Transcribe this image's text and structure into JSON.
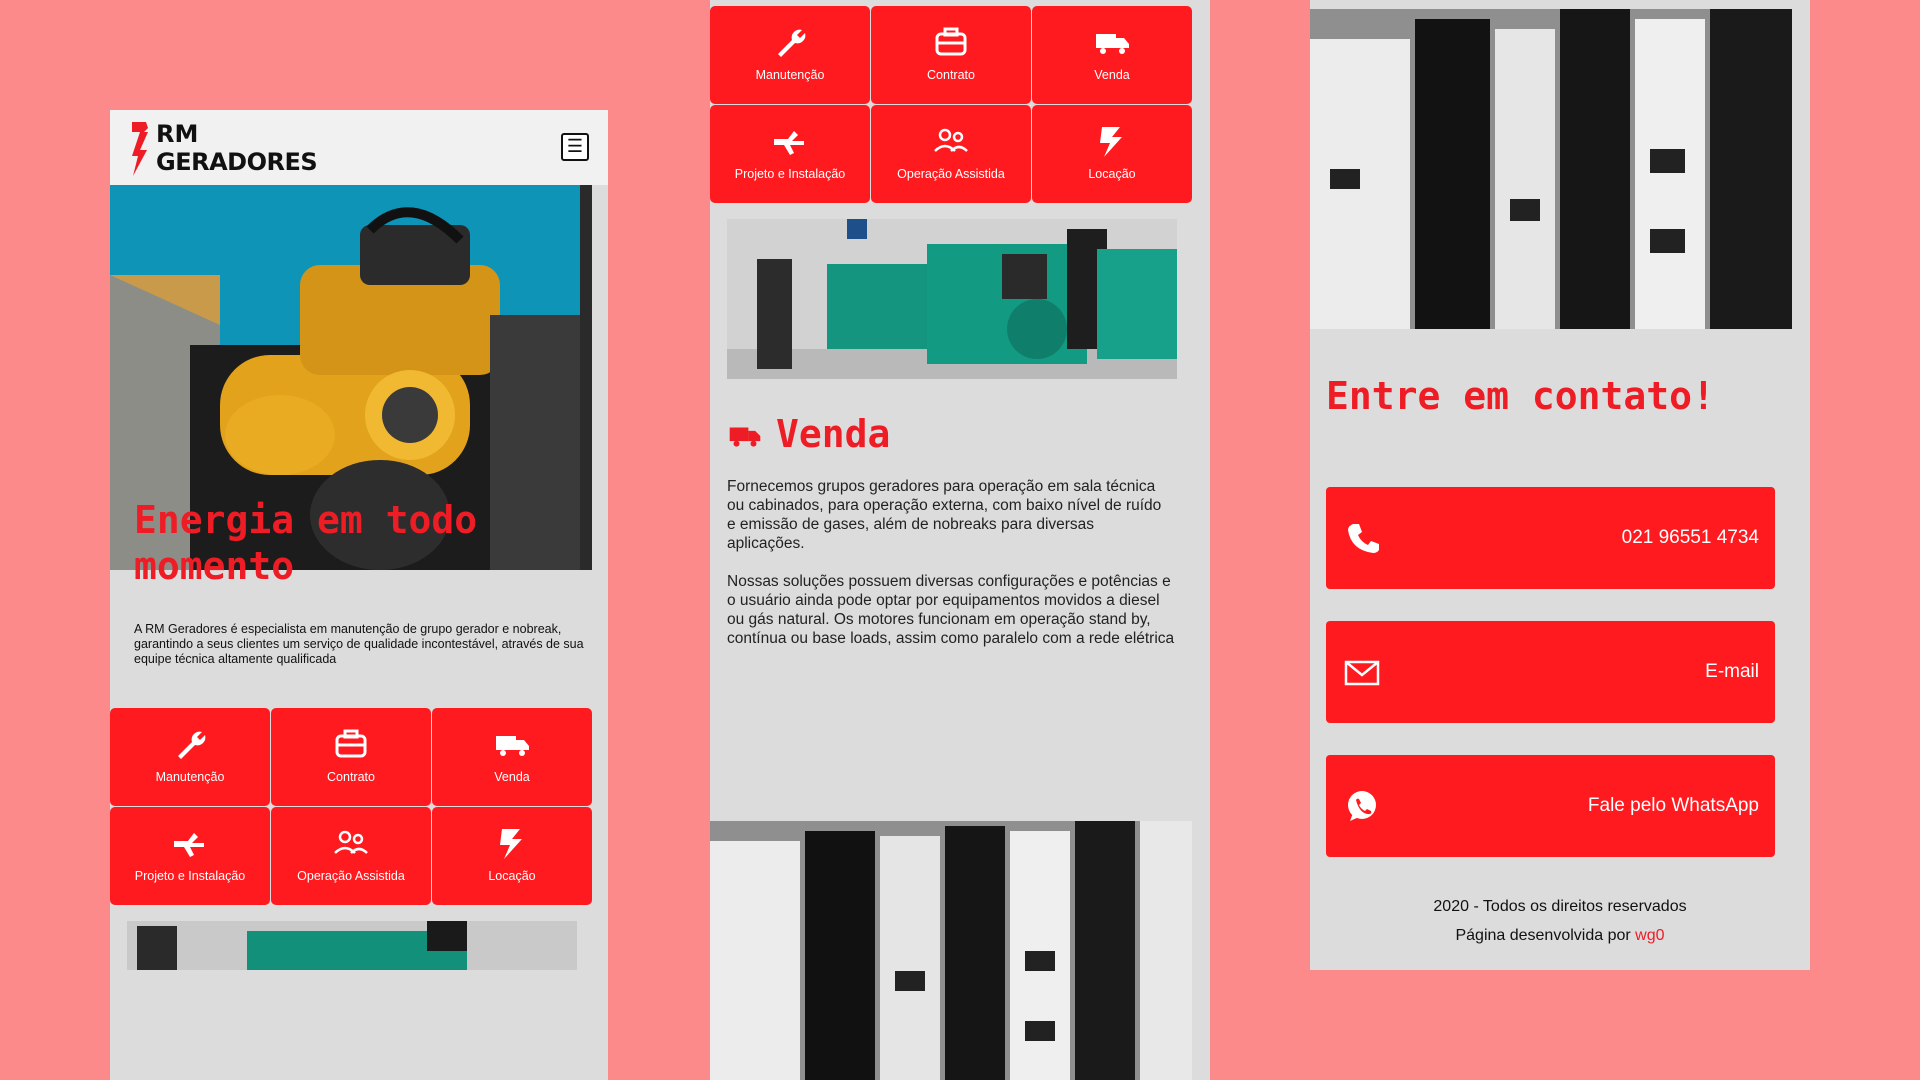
{
  "brand": {
    "line1": "RM",
    "line2": "GERADORES"
  },
  "menu_icon": "hamburger-icon",
  "hero": {
    "title": "Energia em todo momento",
    "text": "A RM Geradores é especialista em manutenção de grupo gerador e nobreak, garantindo a seus clientes um serviço de qualidade incontestável, através de sua equipe técnica altamente qualificada"
  },
  "services": [
    {
      "label": "Manutenção",
      "icon": "wrench-icon"
    },
    {
      "label": "Contrato",
      "icon": "toolbox-icon"
    },
    {
      "label": "Venda",
      "icon": "truck-icon"
    },
    {
      "label": "Projeto e Instalação",
      "icon": "installation-icon"
    },
    {
      "label": "Operação Assistida",
      "icon": "workers-icon"
    },
    {
      "label": "Locação",
      "icon": "lightning-icon"
    }
  ],
  "venda": {
    "title": "Venda",
    "p1": "Fornecemos grupos geradores para operação em sala técnica ou cabinados, para operação externa, com baixo nível de ruído e emissão de gases, além de nobreaks para diversas aplicações.",
    "p2": "Nossas soluções possuem diversas configurações e potências e o usuário ainda pode optar por equipamentos movidos a diesel ou gás natural. Os motores funcionam em operação stand by, contínua ou base loads, assim como paralelo com a rede elétrica"
  },
  "contact": {
    "title": "Entre em contato!",
    "phone": "021 96551 4734",
    "email": "E-mail",
    "whatsapp": "Fale pelo WhatsApp"
  },
  "footer": {
    "rights": "2020 - Todos os direitos reservados",
    "dev_prefix": "Página desenvolvida por",
    "dev_link": "wg0"
  },
  "colors": {
    "accent": "#ff1a1f",
    "background": "#fd8a8a",
    "panel": "#dcdcdc"
  }
}
